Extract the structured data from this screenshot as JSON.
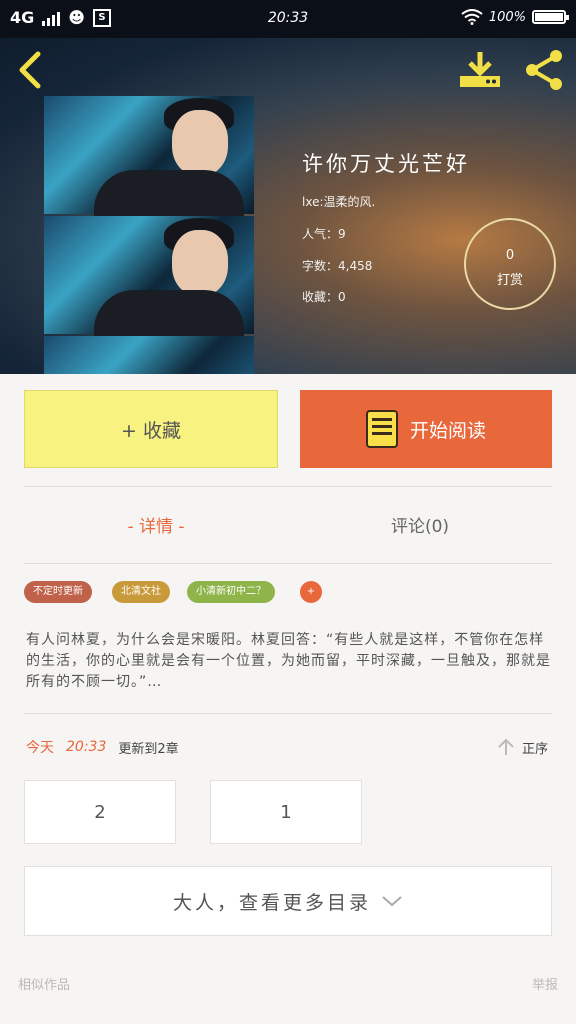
{
  "status_bar": {
    "network": "4G",
    "time": "20:33",
    "battery": "100%",
    "battery_level": 1.0
  },
  "header": {
    "back_icon": "chevron-left-icon",
    "download_icon": "download-icon",
    "share_icon": "share-icon"
  },
  "book": {
    "title": "许你万丈光芒好",
    "author": "lxe:温柔的风.",
    "popularity": "人气：9",
    "word_count": "字数：4,458",
    "favorites": "收藏：0",
    "reward_count": "0",
    "reward_label": "打赏"
  },
  "actions": {
    "favorite_label": "+ 收藏",
    "read_label": "开始阅读",
    "colors": {
      "favorite": "#f8f280",
      "read": "#e8673b"
    }
  },
  "tabs": [
    {
      "label": "- 详情 -",
      "active": true
    },
    {
      "label": "评论(0)",
      "active": false
    }
  ],
  "tags": [
    {
      "label": "不定时更新",
      "color": "#c0624a"
    },
    {
      "label": "北清文社",
      "color": "#c99a3a"
    },
    {
      "label": "小清新初中二？",
      "color": "#8fb44a"
    },
    {
      "label": "+",
      "color": "#e8673b"
    }
  ],
  "description": "有人问林夏，为什么会是宋暖阳。林夏回答：“有些人就是这样，不管你在怎样的生活，你的心里就是会有一个位置，为她而留，平时深藏，一旦触及，那就是所有的不顾一切。”…",
  "update": {
    "today": "今天",
    "time": "20:33",
    "text": "更新到2章",
    "sort_label": "正序"
  },
  "chapters": [
    "2",
    "1"
  ],
  "more_catalog": "大人，查看更多目录",
  "footer": {
    "similar": "相似作品",
    "report": "举报"
  }
}
